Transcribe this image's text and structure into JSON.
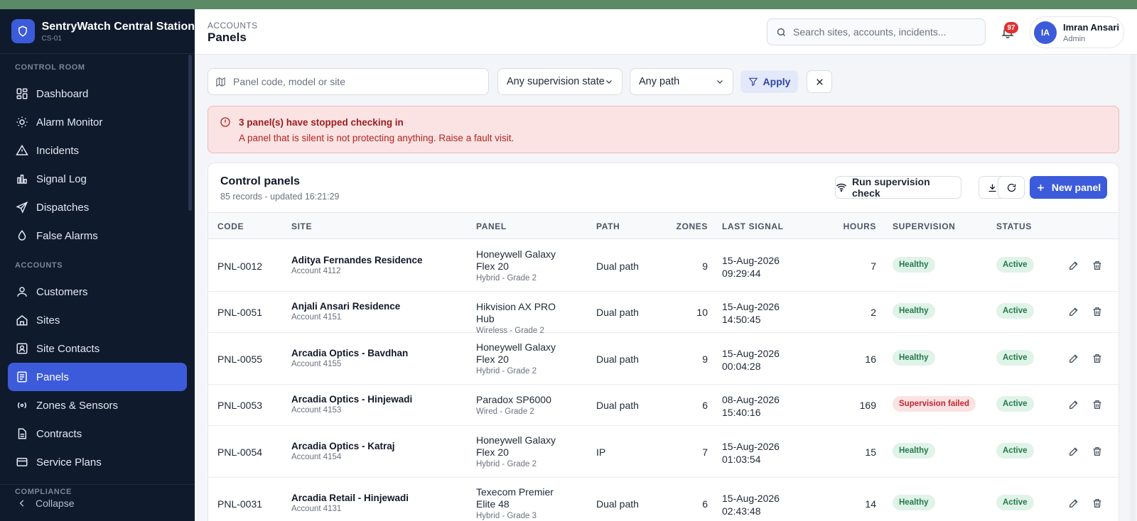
{
  "app": {
    "name": "SentryWatch Central Station",
    "station_code": "CS-01",
    "accent": "#3b5bdb",
    "sidebar_bg": "#0f1a2c"
  },
  "sidebar": {
    "sections": [
      {
        "label": "CONTROL ROOM",
        "items": [
          {
            "label": "Dashboard",
            "icon": "grid-icon"
          },
          {
            "label": "Alarm Monitor",
            "icon": "sun-icon"
          },
          {
            "label": "Incidents",
            "icon": "warning-icon"
          },
          {
            "label": "Signal Log",
            "icon": "bar-chart-icon"
          },
          {
            "label": "Dispatches",
            "icon": "send-icon"
          },
          {
            "label": "False Alarms",
            "icon": "drop-icon"
          }
        ]
      },
      {
        "label": "ACCOUNTS",
        "items": [
          {
            "label": "Customers",
            "icon": "user-icon"
          },
          {
            "label": "Sites",
            "icon": "home-icon"
          },
          {
            "label": "Site Contacts",
            "icon": "contact-icon"
          },
          {
            "label": "Panels",
            "icon": "panel-icon",
            "active": true
          },
          {
            "label": "Zones & Sensors",
            "icon": "radio-icon"
          },
          {
            "label": "Contracts",
            "icon": "file-icon"
          },
          {
            "label": "Service Plans",
            "icon": "card-icon"
          }
        ]
      },
      {
        "label": "COMPLIANCE",
        "items": []
      }
    ],
    "collapse_label": "Collapse"
  },
  "header": {
    "breadcrumb": "ACCOUNTS",
    "title": "Panels",
    "search_placeholder": "Search sites, accounts, incidents...",
    "notifications_count": "97",
    "user": {
      "initials": "IA",
      "name": "Imran Ansari",
      "role": "Admin"
    }
  },
  "filters": {
    "search_placeholder": "Panel code, model or site",
    "supervision_select": "Any supervision state",
    "path_select": "Any path",
    "apply_label": "Apply"
  },
  "alert": {
    "title": "3 panel(s) have stopped checking in",
    "message": "A panel that is silent is not protecting anything. Raise a fault visit."
  },
  "card": {
    "title": "Control panels",
    "subtitle": "85 records - updated 16:21:29",
    "run_check_label": "Run supervision check",
    "new_panel_label": "New panel"
  },
  "table": {
    "columns": [
      "CODE",
      "SITE",
      "PANEL",
      "PATH",
      "ZONES",
      "LAST SIGNAL",
      "HOURS",
      "SUPERVISION",
      "STATUS"
    ],
    "rows": [
      {
        "code": "PNL-0012",
        "site": "Aditya Fernandes Residence",
        "account": "Account 4112",
        "panel": "Honeywell Galaxy Flex 20",
        "panel_meta": "Hybrid - Grade 2",
        "path": "Dual path",
        "zones": "9",
        "date": "15-Aug-2026",
        "time": "09:29:44",
        "hours": "7",
        "supervision": "Healthy",
        "status": "Active"
      },
      {
        "code": "PNL-0051",
        "site": "Anjali Ansari Residence",
        "account": "Account 4151",
        "panel": "Hikvision AX PRO Hub",
        "panel_meta": "Wireless - Grade 2",
        "path": "Dual path",
        "zones": "10",
        "date": "15-Aug-2026",
        "time": "14:50:45",
        "hours": "2",
        "supervision": "Healthy",
        "status": "Active"
      },
      {
        "code": "PNL-0055",
        "site": "Arcadia Optics - Bavdhan",
        "account": "Account 4155",
        "panel": "Honeywell Galaxy Flex 20",
        "panel_meta": "Hybrid - Grade 2",
        "path": "Dual path",
        "zones": "9",
        "date": "15-Aug-2026",
        "time": "00:04:28",
        "hours": "16",
        "supervision": "Healthy",
        "status": "Active"
      },
      {
        "code": "PNL-0053",
        "site": "Arcadia Optics - Hinjewadi",
        "account": "Account 4153",
        "panel": "Paradox SP6000",
        "panel_meta": "Wired - Grade 2",
        "path": "Dual path",
        "zones": "6",
        "date": "08-Aug-2026",
        "time": "15:40:16",
        "hours": "169",
        "supervision": "Supervision failed",
        "status": "Active"
      },
      {
        "code": "PNL-0054",
        "site": "Arcadia Optics - Katraj",
        "account": "Account 4154",
        "panel": "Honeywell Galaxy Flex 20",
        "panel_meta": "Hybrid - Grade 2",
        "path": "IP",
        "zones": "7",
        "date": "15-Aug-2026",
        "time": "01:03:54",
        "hours": "15",
        "supervision": "Healthy",
        "status": "Active"
      },
      {
        "code": "PNL-0031",
        "site": "Arcadia Retail - Hinjewadi",
        "account": "Account 4131",
        "panel": "Texecom Premier Elite 48",
        "panel_meta": "Hybrid - Grade 3",
        "path": "Dual path",
        "zones": "6",
        "date": "15-Aug-2026",
        "time": "02:43:48",
        "hours": "14",
        "supervision": "Healthy",
        "status": "Active"
      }
    ]
  }
}
